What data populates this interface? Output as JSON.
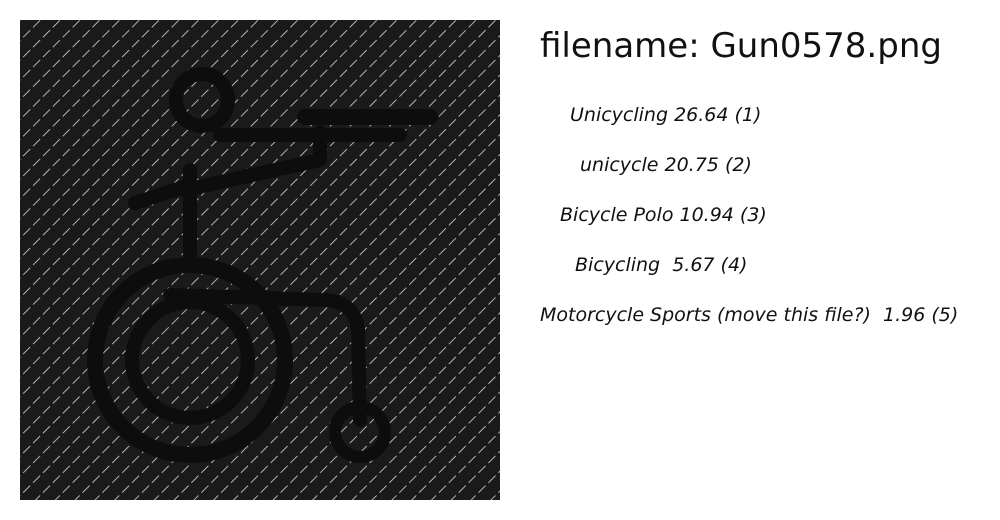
{
  "header": {
    "filename_label": "filename: Gun0578.png"
  },
  "image": {
    "icon": "wheelchair-user-pointing-gun-icon",
    "background_color": "#1a1a1a",
    "hatch_color": "#d9d9d9",
    "figure_color": "#0d0d0d"
  },
  "suggestions": [
    {
      "label": "Unicycling 26.64 (1)"
    },
    {
      "label": "unicycle 20.75 (2)"
    },
    {
      "label": "Bicycle Polo 10.94 (3)"
    },
    {
      "label": "Bicycling  5.67 (4)"
    },
    {
      "label": "Motorcycle Sports (move this file?)  1.96 (5)"
    }
  ]
}
